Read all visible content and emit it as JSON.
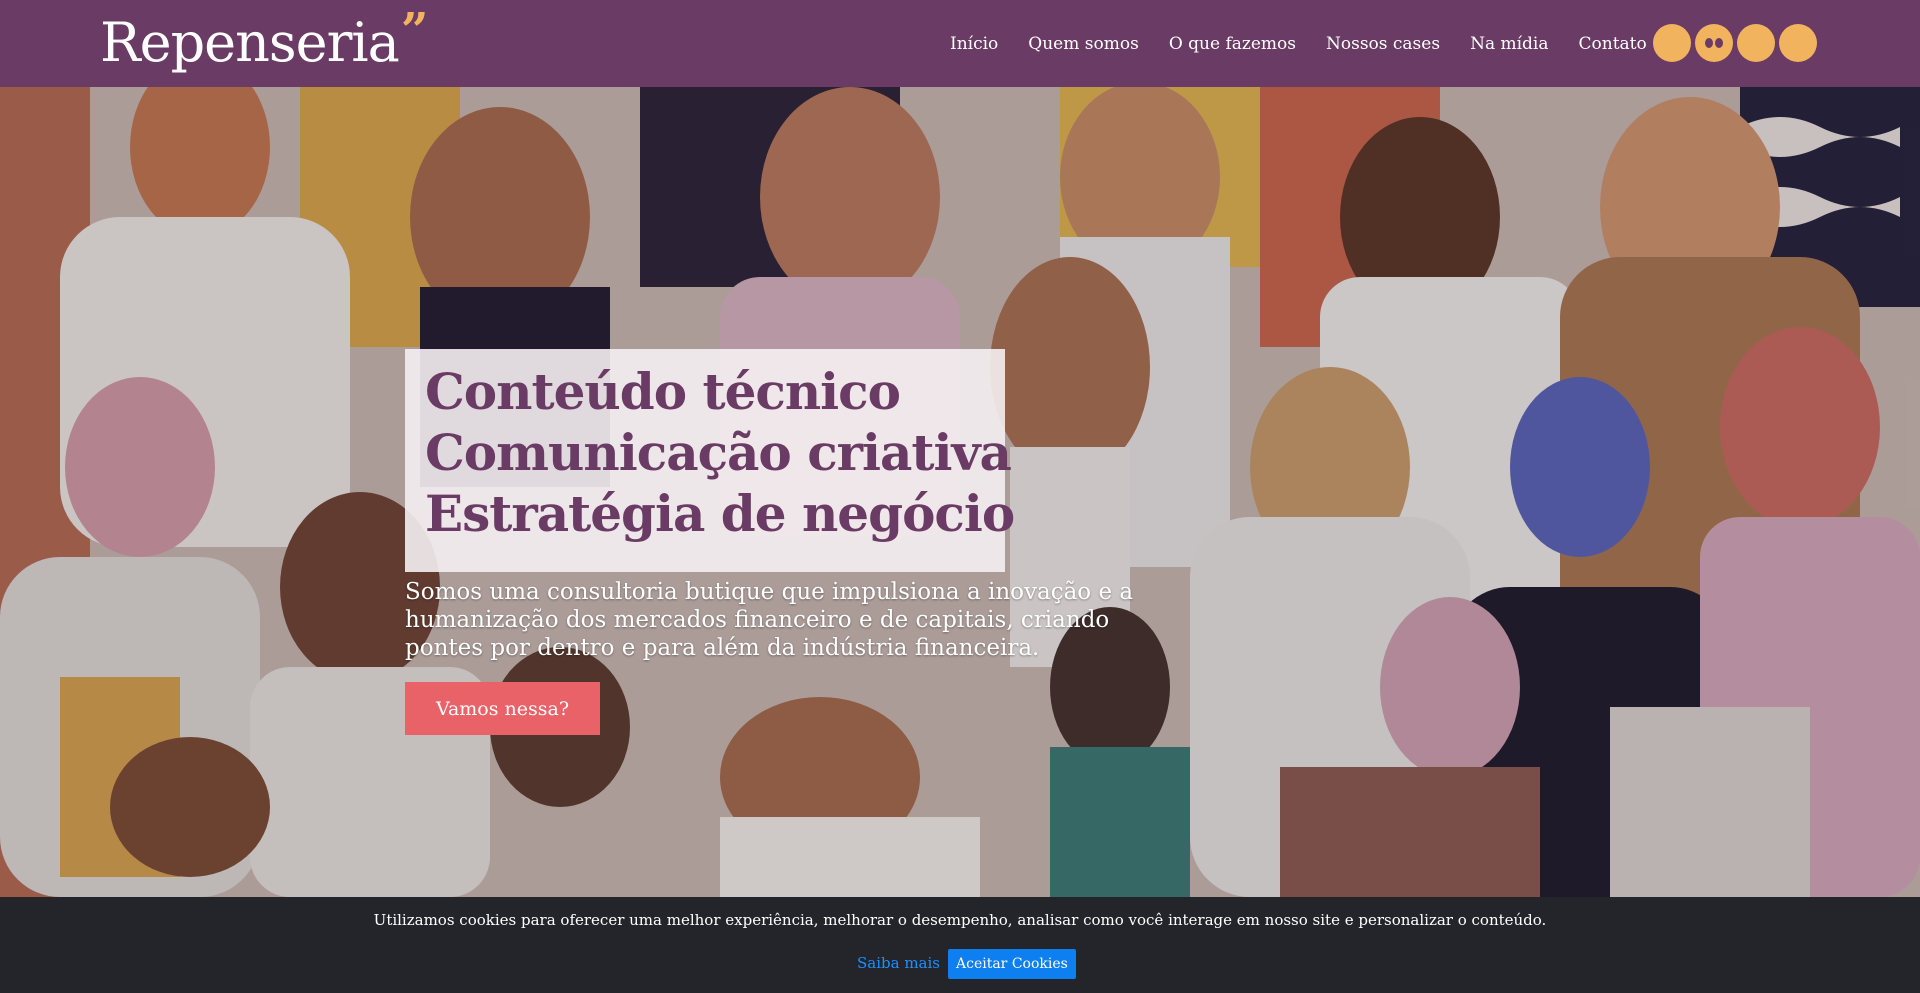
{
  "brand": {
    "logo_text": "Repenseria",
    "logo_quote": "”"
  },
  "nav": {
    "items": [
      "Início",
      "Quem somos",
      "O que fazemos",
      "Nossos cases",
      "Na mídia",
      "Contato"
    ]
  },
  "socials": [
    {
      "icon": "social-circle-icon"
    },
    {
      "icon": "medium-icon"
    },
    {
      "icon": "social-circle-icon"
    },
    {
      "icon": "social-circle-icon"
    }
  ],
  "hero": {
    "headlines": [
      "Conteúdo técnico",
      "Comunicação criativa",
      "Estratégia de negócio"
    ],
    "subtitle": "Somos uma consultoria butique que impulsiona a inovação e a humanização dos mercados financeiro e de capitais, criando pontes por dentro e para além da indústria financeira.",
    "cta_label": "Vamos nessa?"
  },
  "cookie": {
    "text": "Utilizamos cookies para oferecer uma melhor experiência, melhorar o desempenho, analisar como você interage em nosso site e personalizar o conteúdo.",
    "learn_more": "Saiba mais",
    "accept": "Aceitar Cookies"
  },
  "colors": {
    "header_bg": "#6a3b64",
    "accent_yellow": "#f2b35e",
    "headline": "#6a3b64",
    "cta_bg": "#e86268",
    "cookie_bg": "#23252b",
    "cookie_button": "#0d7ff0"
  }
}
